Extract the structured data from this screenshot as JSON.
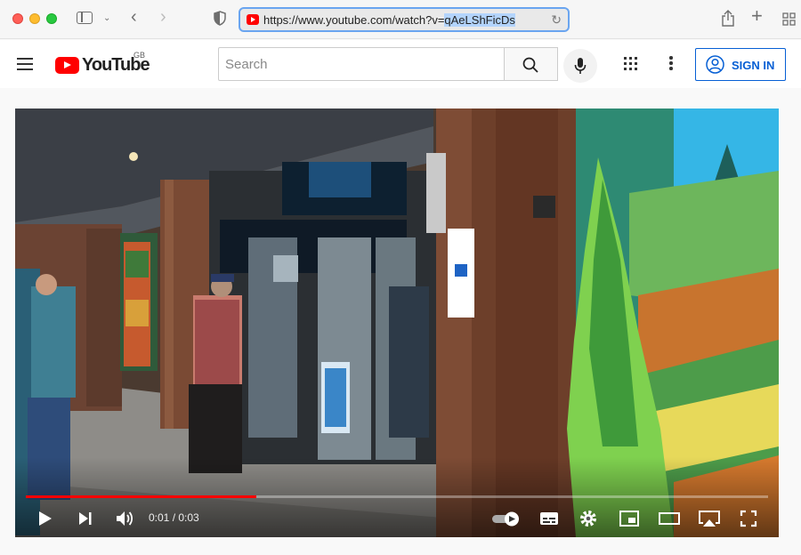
{
  "browser": {
    "url_prefix": "https://www.youtube.com/watch?v=",
    "url_selected": "qAeLShFicDs"
  },
  "header": {
    "logo_text": "YouTube",
    "region": "GB",
    "search_placeholder": "Search",
    "signin_label": "SIGN IN"
  },
  "player": {
    "current_time": "0:01",
    "separator": " / ",
    "duration": "0:03",
    "progress_fraction": 0.31,
    "accent_color": "#ff0000"
  },
  "icons": [
    "sidebar-icon",
    "chevron-down-icon",
    "back-icon",
    "forward-icon",
    "shield-icon",
    "reload-icon",
    "share-icon",
    "new-tab-icon",
    "tabs-overview-icon",
    "menu-icon",
    "search-icon",
    "mic-icon",
    "apps-icon",
    "more-icon",
    "account-icon",
    "play-icon",
    "next-icon",
    "volume-icon",
    "autoplay-toggle-icon",
    "subtitles-icon",
    "settings-icon",
    "miniplayer-icon",
    "theater-icon",
    "airplay-icon",
    "fullscreen-icon"
  ]
}
